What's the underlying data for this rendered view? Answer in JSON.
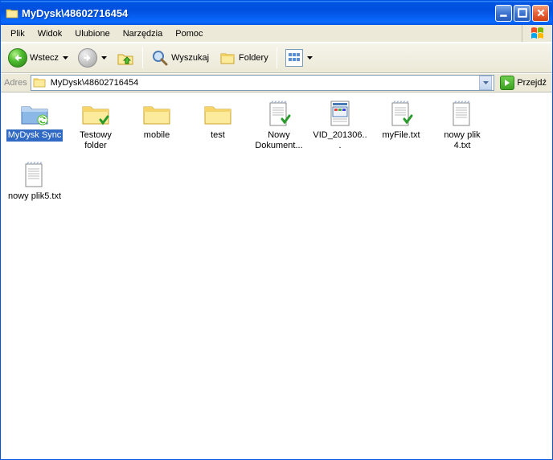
{
  "window": {
    "title": "MyDysk\\48602716454"
  },
  "menu": {
    "items": [
      "Plik",
      "Widok",
      "Ulubione",
      "Narzędzia",
      "Pomoc"
    ]
  },
  "toolbar": {
    "back_label": "Wstecz",
    "search_label": "Wyszukaj",
    "folders_label": "Foldery"
  },
  "addressbar": {
    "label": "Adres",
    "path": "MyDysk\\48602716454",
    "go_label": "Przejdź"
  },
  "items": [
    {
      "type": "sync-folder",
      "label": "MyDysk Sync",
      "selected": true
    },
    {
      "type": "folder-check",
      "label": "Testowy folder"
    },
    {
      "type": "folder",
      "label": "mobile"
    },
    {
      "type": "folder",
      "label": "test"
    },
    {
      "type": "doc-check",
      "label": "Nowy Dokument..."
    },
    {
      "type": "video",
      "label": "VID_201306..."
    },
    {
      "type": "text-check",
      "label": "myFile.txt"
    },
    {
      "type": "text",
      "label": "nowy plik 4.txt"
    },
    {
      "type": "text",
      "label": "nowy plik5.txt"
    }
  ]
}
